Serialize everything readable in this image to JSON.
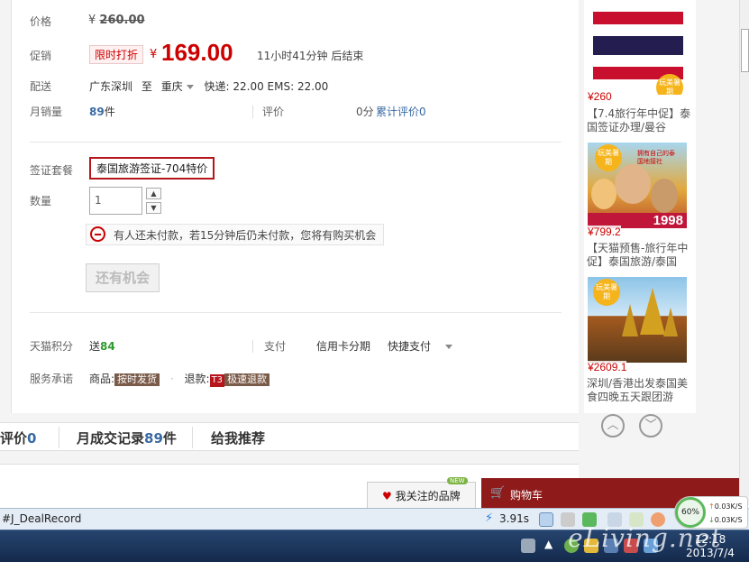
{
  "product": {
    "price_label": "价格",
    "original_price_currency": "¥",
    "original_price": "260.00",
    "promo_label": "促销",
    "promo_tag": "限时打折",
    "promo_currency": "¥",
    "promo_price": "169.00",
    "countdown": "11小时41分钟 后结束",
    "delivery_label": "配送",
    "ship_from": "广东深圳",
    "ship_to_word": "至",
    "ship_to": "重庆",
    "shipping_fees": "快递: 22.00 EMS: 22.00",
    "monthly_sales_label": "月销量",
    "monthly_sales_count": "89",
    "monthly_sales_unit": "件",
    "review_label": "评价",
    "score": "0分",
    "cumulative_reviews": "累计评价0",
    "package_label": "签证套餐",
    "package_option": "泰国旅游签证-704特价",
    "quantity_label": "数量",
    "quantity_value": "1",
    "warning_text": "有人还未付款，若15分钟后仍未付款，您将有购买机会",
    "chance_button": "还有机会",
    "points_label": "天猫积分",
    "points_prefix": "送",
    "points_value": "84",
    "payment_label": "支付",
    "payment_credit": "信用卡分期",
    "payment_quick": "快捷支付",
    "service_label": "服务承诺",
    "goods_prefix": "商品:",
    "goods_tag": "按时发货",
    "refund_prefix": "退款:",
    "refund_code": "T3",
    "refund_tag": "极速退款"
  },
  "tabs": {
    "reviews_label": "评价",
    "reviews_count": "0",
    "records_label": "月成交记录",
    "records_count": "89",
    "records_unit": "件",
    "recommend_label": "给我推荐"
  },
  "sidebar": {
    "items": [
      {
        "price": "¥260",
        "title": "【7.4旅行年中促】泰国签证办理/曼谷"
      },
      {
        "price": "¥799.2",
        "title": "【天猫预售-旅行年中促】泰国旅游/泰国",
        "thumb_text": "1998",
        "thumb_sub": "拥有自己的泰国地接社"
      },
      {
        "price": "¥2609.1",
        "title": "深圳/香港出发泰国美食四晚五天跟团游"
      }
    ],
    "badge_text": "玩美暑期"
  },
  "bottom_bar": {
    "brand_button": "我关注的品牌",
    "new_badge": "NEW",
    "cart_label": "购物车"
  },
  "statusbar": {
    "left_text": "#J_DealRecord",
    "load_time": "3.91s"
  },
  "network_widget": {
    "percent": "60%",
    "up": "0.03K/S",
    "down": "0.03K/S"
  },
  "taskbar": {
    "time": "12:18",
    "date": "2013/7/4"
  },
  "watermark": "eLiving.net",
  "colors": {
    "price_red": "#cc0000",
    "dark_red": "#b5151b",
    "link_blue": "#3a6aa3",
    "points_green": "#2f9a2f"
  }
}
